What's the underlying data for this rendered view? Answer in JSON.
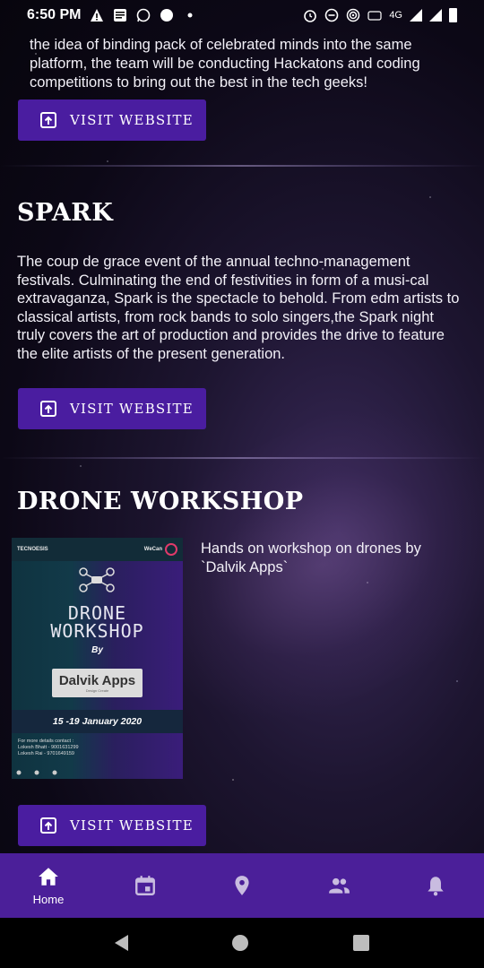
{
  "status_bar": {
    "time": "6:50 PM",
    "network": "4G"
  },
  "intro": {
    "text": "the idea of binding pack of celebrated minds into the same platform, the team will be conducting Hackatons and coding competitions to bring out the best in the tech geeks!"
  },
  "visit_label": "VISIT WEBSITE",
  "spark": {
    "title": "SPARK",
    "body": " The coup de grace event of the annual techno-management festivals.  Culminating the end of festivities in form of a musi-cal extravaganza, Spark is the spectacle to behold. From edm artists to classical artists, from rock bands to solo singers,the Spark night truly covers the art of production and provides the drive to feature the elite artists of the present generation."
  },
  "drone": {
    "title": "DRONE WORKSHOP",
    "description": "Hands on workshop on drones by `Dalvik Apps`",
    "poster": {
      "brand_left": "TECNOESIS",
      "brand_right": "WeCan",
      "line1": "DRONE",
      "line2": "WORKSHOP",
      "by": "By",
      "company": "Dalvik Apps",
      "company_sub": "Design  Create",
      "date": "15 -19 January 2020",
      "contact": "For more details contact :\nLokesh Bhatt - 9001631299\nLokesh Rai - 9701649159"
    }
  },
  "bottom_nav": {
    "items": [
      {
        "label": "Home",
        "icon": "home-icon"
      },
      {
        "label": "",
        "icon": "calendar-icon"
      },
      {
        "label": "",
        "icon": "location-icon"
      },
      {
        "label": "",
        "icon": "people-icon"
      },
      {
        "label": "",
        "icon": "bell-icon"
      }
    ]
  },
  "colors": {
    "accent": "#4b1f99",
    "button": "#4a1da0"
  }
}
